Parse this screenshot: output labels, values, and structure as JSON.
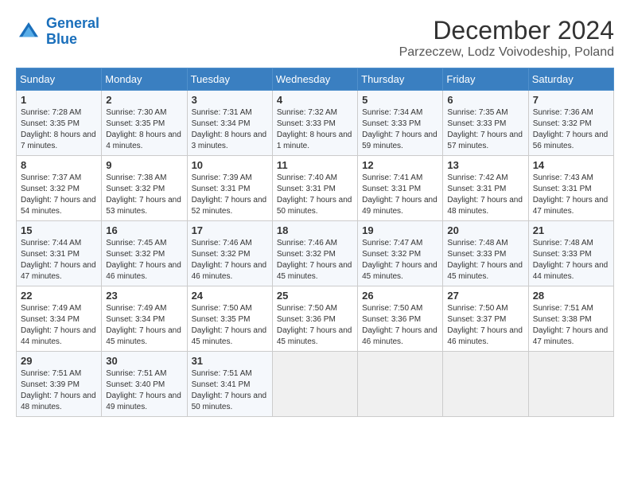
{
  "header": {
    "logo_line1": "General",
    "logo_line2": "Blue",
    "month_title": "December 2024",
    "subtitle": "Parzeczew, Lodz Voivodeship, Poland"
  },
  "weekdays": [
    "Sunday",
    "Monday",
    "Tuesday",
    "Wednesday",
    "Thursday",
    "Friday",
    "Saturday"
  ],
  "weeks": [
    [
      {
        "day": "1",
        "sunrise": "7:28 AM",
        "sunset": "3:35 PM",
        "daylight": "8 hours and 7 minutes."
      },
      {
        "day": "2",
        "sunrise": "7:30 AM",
        "sunset": "3:35 PM",
        "daylight": "8 hours and 4 minutes."
      },
      {
        "day": "3",
        "sunrise": "7:31 AM",
        "sunset": "3:34 PM",
        "daylight": "8 hours and 3 minutes."
      },
      {
        "day": "4",
        "sunrise": "7:32 AM",
        "sunset": "3:33 PM",
        "daylight": "8 hours and 1 minute."
      },
      {
        "day": "5",
        "sunrise": "7:34 AM",
        "sunset": "3:33 PM",
        "daylight": "7 hours and 59 minutes."
      },
      {
        "day": "6",
        "sunrise": "7:35 AM",
        "sunset": "3:33 PM",
        "daylight": "7 hours and 57 minutes."
      },
      {
        "day": "7",
        "sunrise": "7:36 AM",
        "sunset": "3:32 PM",
        "daylight": "7 hours and 56 minutes."
      }
    ],
    [
      {
        "day": "8",
        "sunrise": "7:37 AM",
        "sunset": "3:32 PM",
        "daylight": "7 hours and 54 minutes."
      },
      {
        "day": "9",
        "sunrise": "7:38 AM",
        "sunset": "3:32 PM",
        "daylight": "7 hours and 53 minutes."
      },
      {
        "day": "10",
        "sunrise": "7:39 AM",
        "sunset": "3:31 PM",
        "daylight": "7 hours and 52 minutes."
      },
      {
        "day": "11",
        "sunrise": "7:40 AM",
        "sunset": "3:31 PM",
        "daylight": "7 hours and 50 minutes."
      },
      {
        "day": "12",
        "sunrise": "7:41 AM",
        "sunset": "3:31 PM",
        "daylight": "7 hours and 49 minutes."
      },
      {
        "day": "13",
        "sunrise": "7:42 AM",
        "sunset": "3:31 PM",
        "daylight": "7 hours and 48 minutes."
      },
      {
        "day": "14",
        "sunrise": "7:43 AM",
        "sunset": "3:31 PM",
        "daylight": "7 hours and 47 minutes."
      }
    ],
    [
      {
        "day": "15",
        "sunrise": "7:44 AM",
        "sunset": "3:31 PM",
        "daylight": "7 hours and 47 minutes."
      },
      {
        "day": "16",
        "sunrise": "7:45 AM",
        "sunset": "3:32 PM",
        "daylight": "7 hours and 46 minutes."
      },
      {
        "day": "17",
        "sunrise": "7:46 AM",
        "sunset": "3:32 PM",
        "daylight": "7 hours and 46 minutes."
      },
      {
        "day": "18",
        "sunrise": "7:46 AM",
        "sunset": "3:32 PM",
        "daylight": "7 hours and 45 minutes."
      },
      {
        "day": "19",
        "sunrise": "7:47 AM",
        "sunset": "3:32 PM",
        "daylight": "7 hours and 45 minutes."
      },
      {
        "day": "20",
        "sunrise": "7:48 AM",
        "sunset": "3:33 PM",
        "daylight": "7 hours and 45 minutes."
      },
      {
        "day": "21",
        "sunrise": "7:48 AM",
        "sunset": "3:33 PM",
        "daylight": "7 hours and 44 minutes."
      }
    ],
    [
      {
        "day": "22",
        "sunrise": "7:49 AM",
        "sunset": "3:34 PM",
        "daylight": "7 hours and 44 minutes."
      },
      {
        "day": "23",
        "sunrise": "7:49 AM",
        "sunset": "3:34 PM",
        "daylight": "7 hours and 45 minutes."
      },
      {
        "day": "24",
        "sunrise": "7:50 AM",
        "sunset": "3:35 PM",
        "daylight": "7 hours and 45 minutes."
      },
      {
        "day": "25",
        "sunrise": "7:50 AM",
        "sunset": "3:36 PM",
        "daylight": "7 hours and 45 minutes."
      },
      {
        "day": "26",
        "sunrise": "7:50 AM",
        "sunset": "3:36 PM",
        "daylight": "7 hours and 46 minutes."
      },
      {
        "day": "27",
        "sunrise": "7:50 AM",
        "sunset": "3:37 PM",
        "daylight": "7 hours and 46 minutes."
      },
      {
        "day": "28",
        "sunrise": "7:51 AM",
        "sunset": "3:38 PM",
        "daylight": "7 hours and 47 minutes."
      }
    ],
    [
      {
        "day": "29",
        "sunrise": "7:51 AM",
        "sunset": "3:39 PM",
        "daylight": "7 hours and 48 minutes."
      },
      {
        "day": "30",
        "sunrise": "7:51 AM",
        "sunset": "3:40 PM",
        "daylight": "7 hours and 49 minutes."
      },
      {
        "day": "31",
        "sunrise": "7:51 AM",
        "sunset": "3:41 PM",
        "daylight": "7 hours and 50 minutes."
      },
      null,
      null,
      null,
      null
    ]
  ]
}
